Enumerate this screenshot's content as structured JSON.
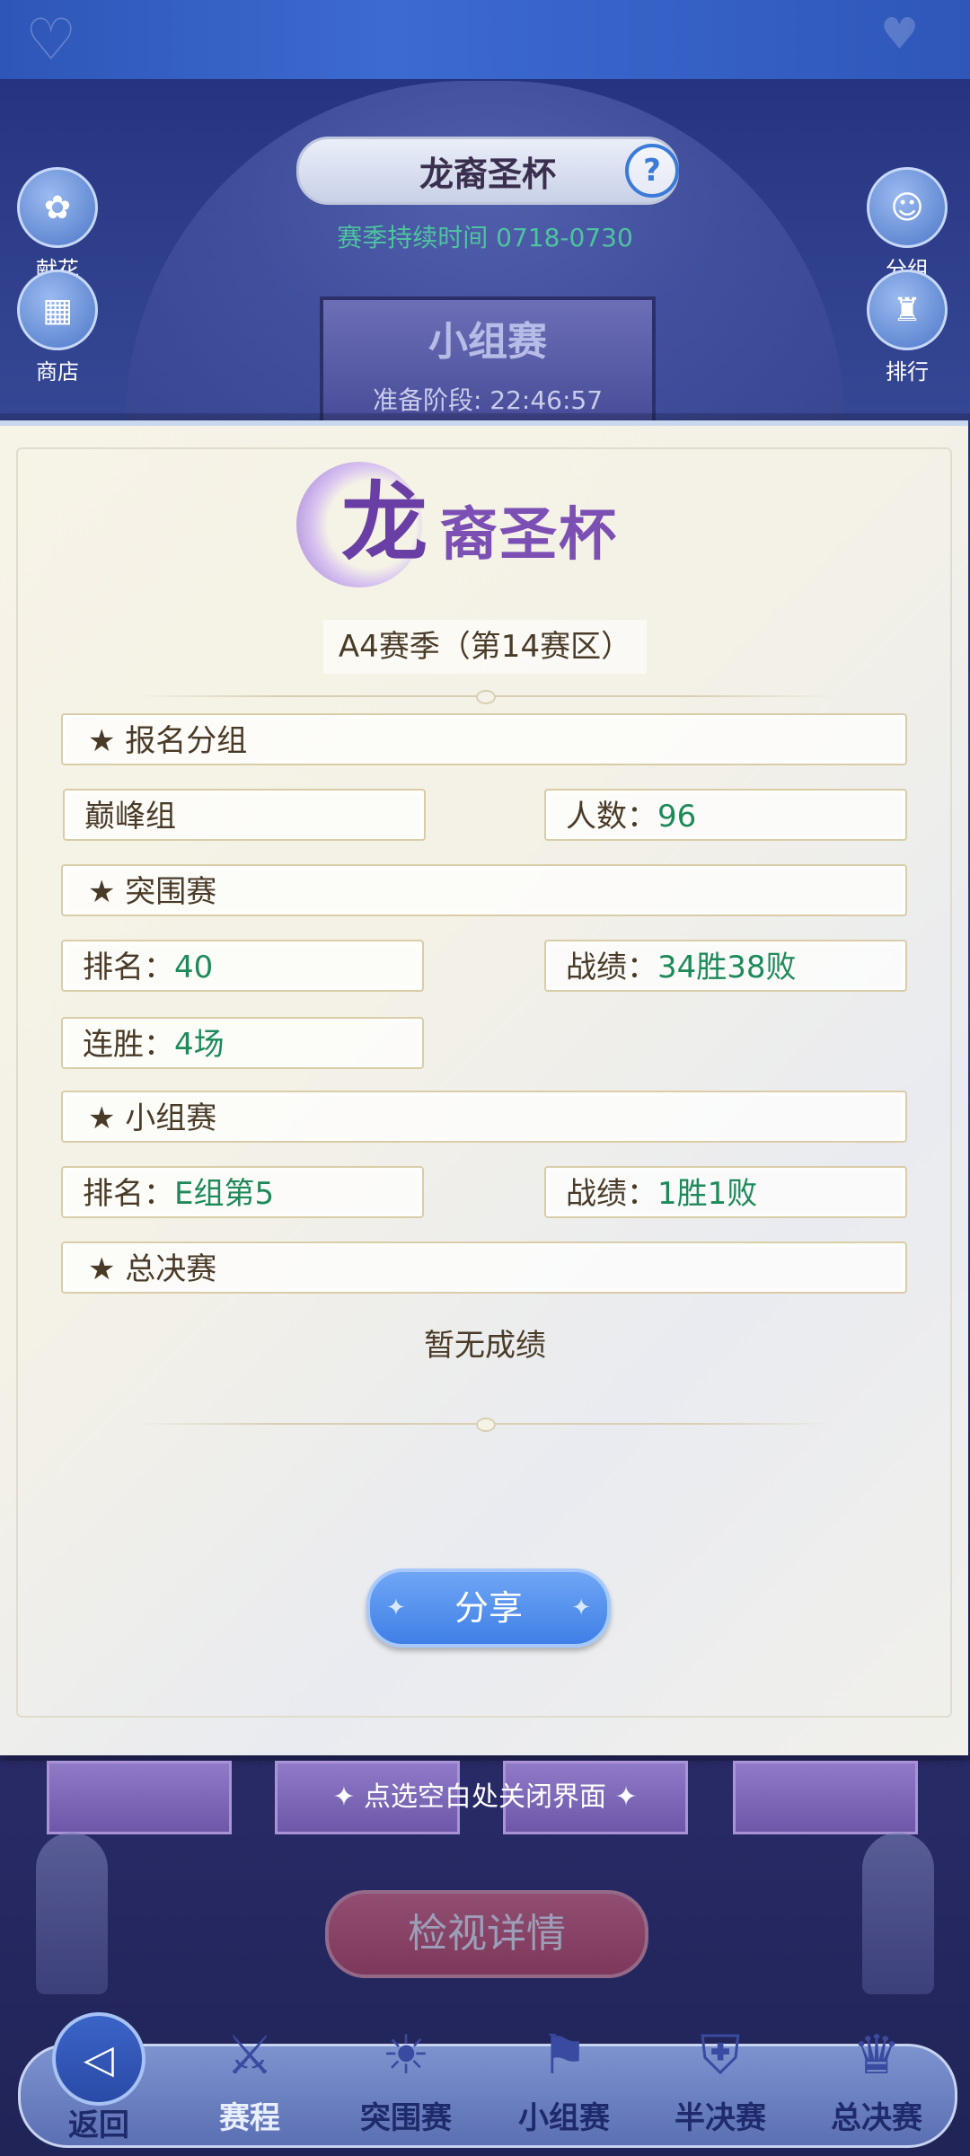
{
  "background": {
    "title": "龙裔圣杯",
    "season_duration": "赛季持续时间 0718-0730",
    "stage_name": "小组赛",
    "stage_countdown": "准备阶段: 22:46:57",
    "left_buttons": [
      {
        "label": "献花",
        "icon": "flower-icon"
      },
      {
        "label": "商店",
        "icon": "shop-icon"
      }
    ],
    "right_buttons": [
      {
        "label": "分组",
        "icon": "group-icon"
      },
      {
        "label": "排行",
        "icon": "ranking-icon"
      }
    ],
    "close_hint": "点选空白处关闭界面",
    "detail_button": "检视详情"
  },
  "modal": {
    "logo": {
      "big": "龙",
      "rest": "裔圣杯"
    },
    "season_label": "A4赛季（第14赛区）",
    "sections": {
      "signup": {
        "title": "★ 报名分组",
        "group": "巅峰组",
        "people_label": "人数：",
        "people_value": "96"
      },
      "breakout": {
        "title": "★ 突围赛",
        "rank_label": "排名：",
        "rank_value": "40",
        "record_label": "战绩：",
        "record_value": "34胜38败",
        "streak_label": "连胜：",
        "streak_value": "4场"
      },
      "group_stage": {
        "title": "★ 小组赛",
        "rank_label": "排名：",
        "rank_value": "E组第5",
        "record_label": "战绩：",
        "record_value": "1胜1败"
      },
      "finals": {
        "title": "★ 总决赛",
        "no_result": "暂无成绩"
      }
    },
    "share_button": "分享"
  },
  "bottom_nav": [
    {
      "label": "返回",
      "icon": "back-icon"
    },
    {
      "label": "赛程",
      "icon": "schedule-icon"
    },
    {
      "label": "突围赛",
      "icon": "breakout-icon"
    },
    {
      "label": "小组赛",
      "icon": "group-stage-icon"
    },
    {
      "label": "半决赛",
      "icon": "semifinal-icon"
    },
    {
      "label": "总决赛",
      "icon": "final-icon"
    }
  ]
}
